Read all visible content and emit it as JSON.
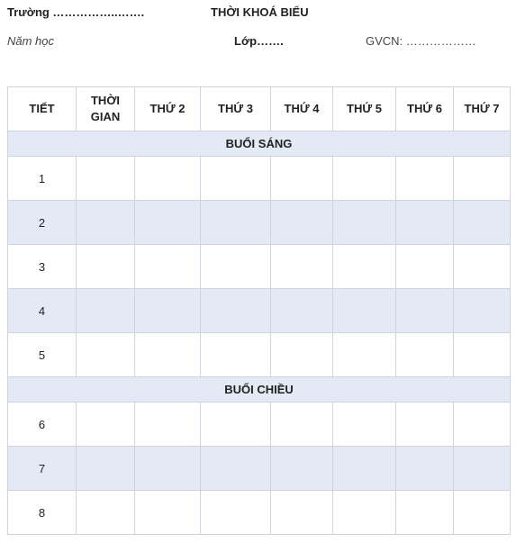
{
  "header": {
    "school": "Trường ……………..…….",
    "title": "THỜI KHOÁ BIỂU",
    "year": "Năm học",
    "class": "Lớp…….",
    "teacher": "GVCN: ………………"
  },
  "table": {
    "columns": [
      "TIẾT",
      "THỜI GIAN",
      "THỨ 2",
      "THỨ 3",
      "THỨ 4",
      "THỨ 5",
      "THỨ 6",
      "THỨ 7"
    ],
    "sessions": [
      {
        "label": "BUỔI SÁNG",
        "periods": [
          "1",
          "2",
          "3",
          "4",
          "5"
        ]
      },
      {
        "label": "BUỔI CHIỀU",
        "periods": [
          "6",
          "7",
          "8"
        ]
      }
    ]
  }
}
